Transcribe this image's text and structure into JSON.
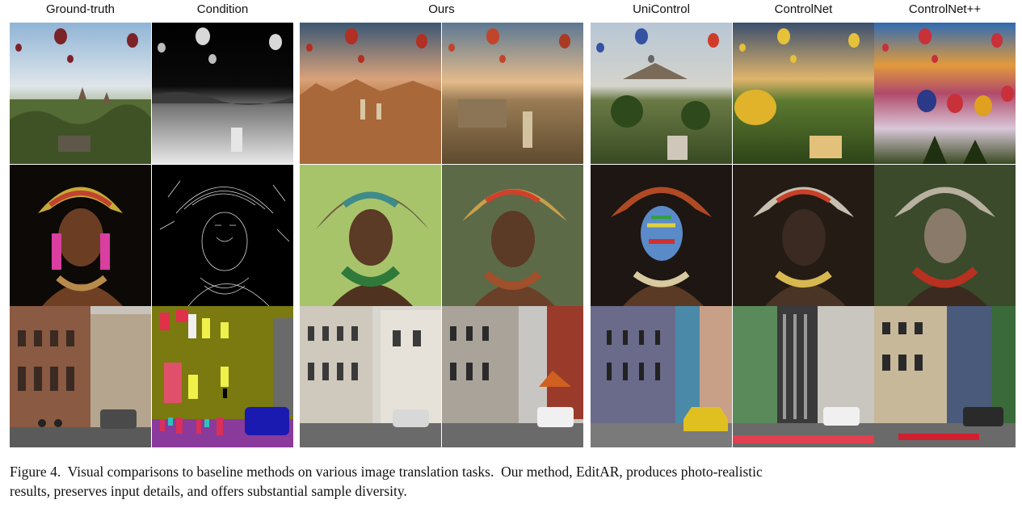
{
  "figure": {
    "columns": [
      "Ground-truth",
      "Condition",
      "Ours",
      "UniControl",
      "ControlNet",
      "ControlNet++"
    ],
    "caption_line1": "Figure 4.  Visual comparisons to baseline methods on various image translation tasks.  Our method, EditAR, produces photo-realistic",
    "caption_line2": "results, preserves input details, and offers substantial sample diversity."
  }
}
